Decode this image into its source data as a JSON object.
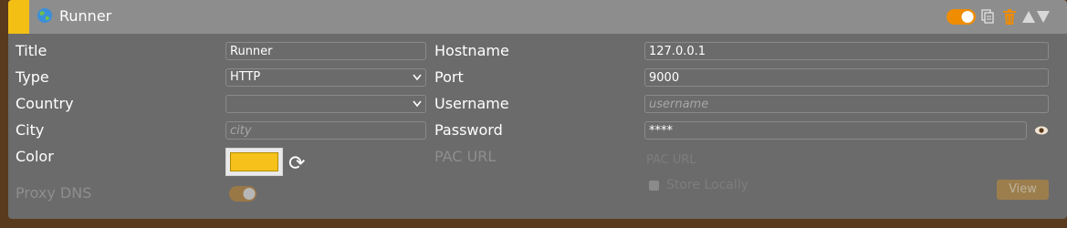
{
  "header": {
    "title": "Runner",
    "accent_color": "#f3bf14",
    "icons": [
      "globe-icon",
      "toggle-switch",
      "copy-icon",
      "trash-icon",
      "move-up-icon",
      "move-down-icon"
    ]
  },
  "form": {
    "title_label": "Title",
    "title_value": "Runner",
    "type_label": "Type",
    "type_value": "HTTP",
    "country_label": "Country",
    "country_value": "",
    "city_label": "City",
    "city_placeholder": "city",
    "color_label": "Color",
    "color_value": "#f5c11a",
    "proxy_dns_label": "Proxy DNS",
    "hostname_label": "Hostname",
    "hostname_value": "127.0.0.1",
    "port_label": "Port",
    "port_value": "9000",
    "username_label": "Username",
    "username_placeholder": "username",
    "password_label": "Password",
    "password_value": "****",
    "pac_url_label": "PAC URL",
    "pac_url_placeholder": "PAC URL",
    "store_locally_label": "Store Locally",
    "view_label": "View"
  }
}
